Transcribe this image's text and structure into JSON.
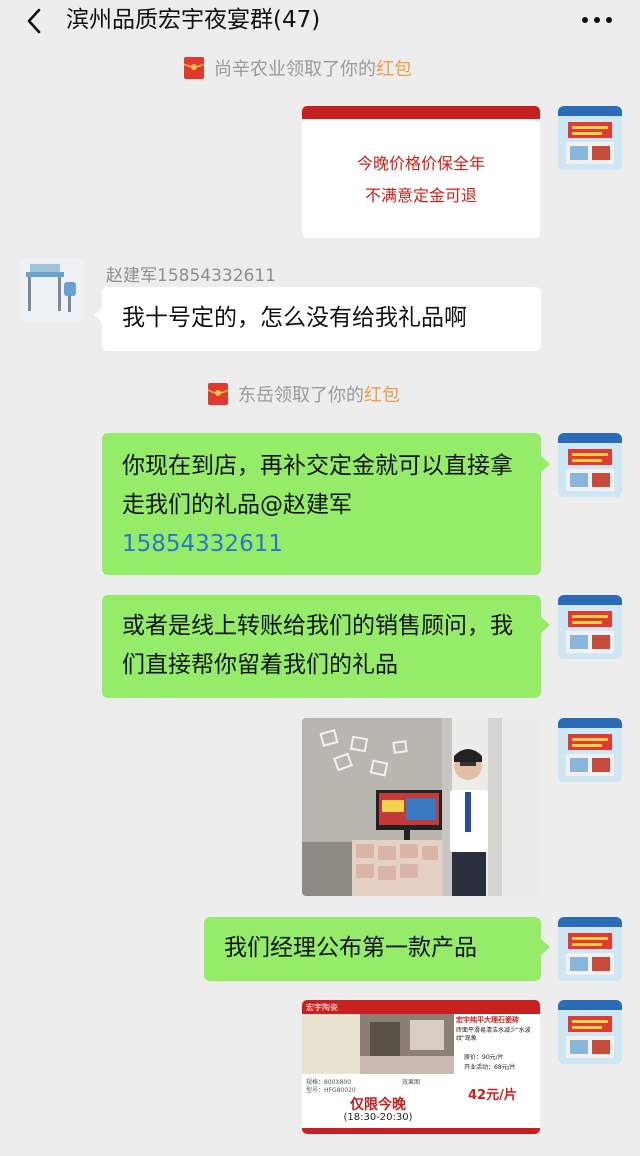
{
  "header": {
    "title": "滨州品质宏宇夜宴群(47)"
  },
  "system_messages": [
    {
      "text": "尚辛农业领取了你的",
      "highlight": "红包"
    },
    {
      "text": "东岳领取了你的",
      "highlight": "红包"
    }
  ],
  "promo_card": {
    "line1": "今晚价格价保全年",
    "line2": "不满意定金可退"
  },
  "incoming": {
    "sender": "赵建军15854332611",
    "text": "我十号定的，怎么没有给我礼品啊"
  },
  "outgoing": [
    {
      "text": "你现在到店，再补交定金就可以直接拿走我们的礼品@赵建军",
      "mention": "15854332611"
    },
    {
      "text": "或者是线上转账给我们的销售顾问，我们直接帮你留着我们的礼品"
    },
    {
      "text": "我们经理公布第一款产品"
    }
  ],
  "product_poster": {
    "brand": "宏宇陶瓷",
    "product_name": "宏宇纯平大理石瓷砖",
    "feature": "砖面平滑易清洁水减少\"水波纹\"现象",
    "original_price": "原价：90元/片",
    "event_price": "开业活动：68元/片",
    "special_price": "42元/片",
    "limit_label": "仅限今晚",
    "time_range": "(18:30-20:30)",
    "size": "规格：800X800",
    "model": "型号：HFG80020",
    "effect_label": "效果图"
  },
  "colors": {
    "bubble_green": "#95ec69",
    "background": "#ededed",
    "mention_blue": "#2c78c8",
    "redpacket_orange": "#e8a04a",
    "poster_red": "#c8201e"
  }
}
